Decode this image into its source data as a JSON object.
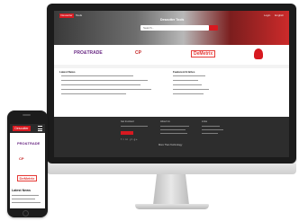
{
  "hero": {
    "logo": "Desoutter",
    "logo2": "Tools",
    "title": "Desoutter Tools",
    "nav": [
      "Login",
      "English"
    ],
    "search_placeholder": "Search..."
  },
  "brands": [
    "PRO&TRADE",
    "CP",
    "DeMetrix",
    ""
  ],
  "news": {
    "heading": "Latest News",
    "right_heading": "Featured Articles"
  },
  "footer": {
    "col1": "Get Involved",
    "col2": "About Us",
    "col3": "Links",
    "social": "f  t  in  yt  g+",
    "bottom": "More Than Technology"
  },
  "phone": {
    "logo": "Desoutter",
    "brands": [
      "PRO&TRADE",
      "CP",
      "DeMetrix"
    ],
    "news_heading": "Latest News"
  }
}
